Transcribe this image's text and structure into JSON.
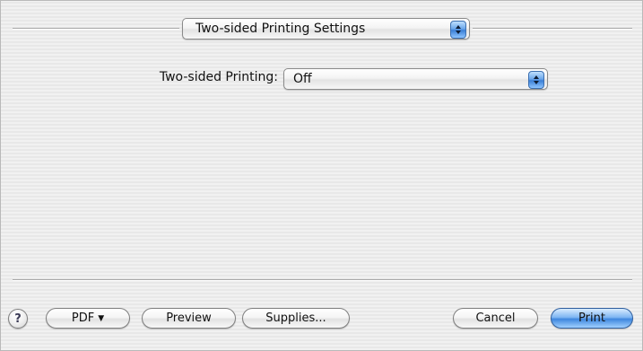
{
  "header": {
    "panel_menu_value": "Two-sided Printing Settings"
  },
  "settings": {
    "two_sided_label": "Two-sided Printing:",
    "two_sided_value": "Off"
  },
  "footer": {
    "help_label": "?",
    "pdf_label": "PDF",
    "pdf_caret": "▼",
    "preview_label": "Preview",
    "supplies_label": "Supplies...",
    "cancel_label": "Cancel",
    "print_label": "Print"
  },
  "colors": {
    "default_button": "#3f87de",
    "stepper": "#3b7fd6"
  },
  "icons": {
    "help": "question-mark-icon",
    "popup_arrows": "up-down-arrows-icon",
    "pdf_dropdown": "chevron-down-icon"
  }
}
